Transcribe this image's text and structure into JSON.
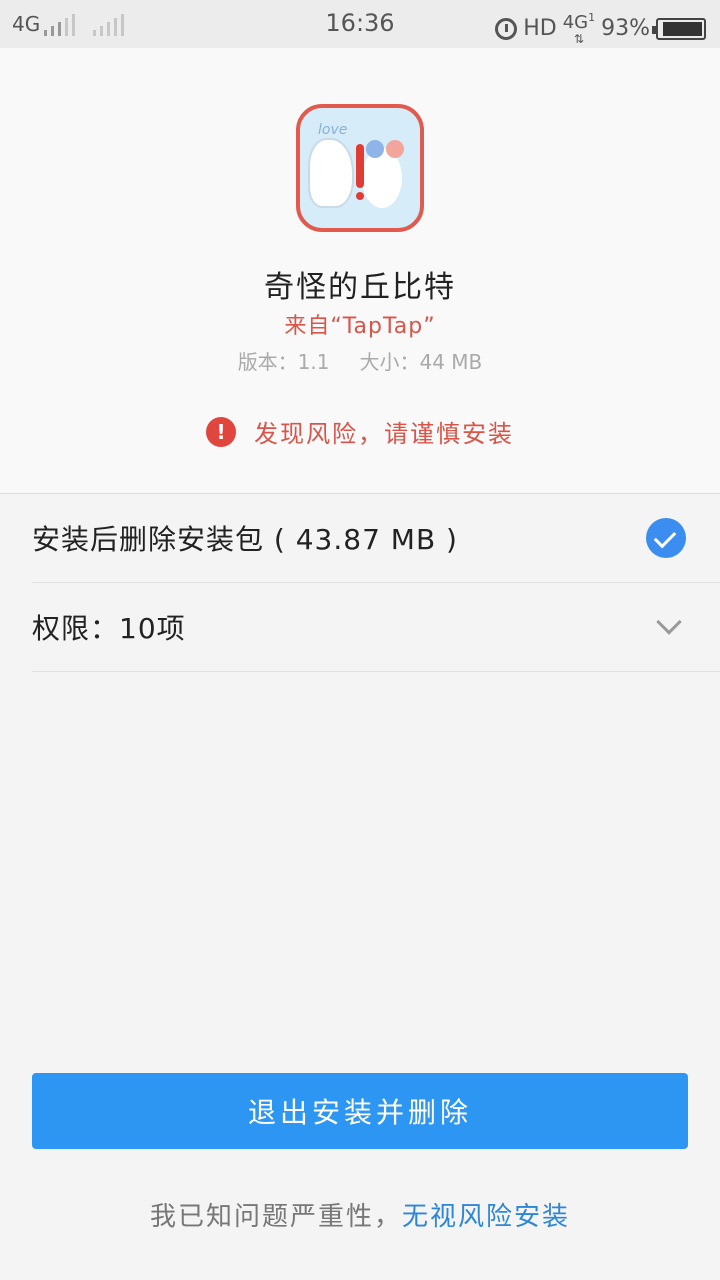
{
  "status_bar": {
    "carrier1": "4G",
    "time": "16:36",
    "hd": "HD",
    "network": "4G",
    "network_sub": "1",
    "battery_percent": "93%",
    "battery_level": 0.93
  },
  "app": {
    "icon": "app-icon-with-warning",
    "name": "奇怪的丘比特",
    "source": "来自“TapTap”",
    "version": "版本：1.1",
    "size": "大小：44 MB",
    "risk_text": "发现风险，请谨慎安装"
  },
  "options": {
    "delete_after_install": "安装后删除安装包 ( 43.87 MB )",
    "delete_checked": true,
    "permissions": "权限：10项"
  },
  "actions": {
    "primary": "退出安装并删除",
    "footer_text": "我已知问题严重性，",
    "footer_link": "无视风险安装"
  },
  "colors": {
    "accent": "#2d96f2",
    "warning": "#e0453e",
    "check": "#3b8ef0"
  }
}
